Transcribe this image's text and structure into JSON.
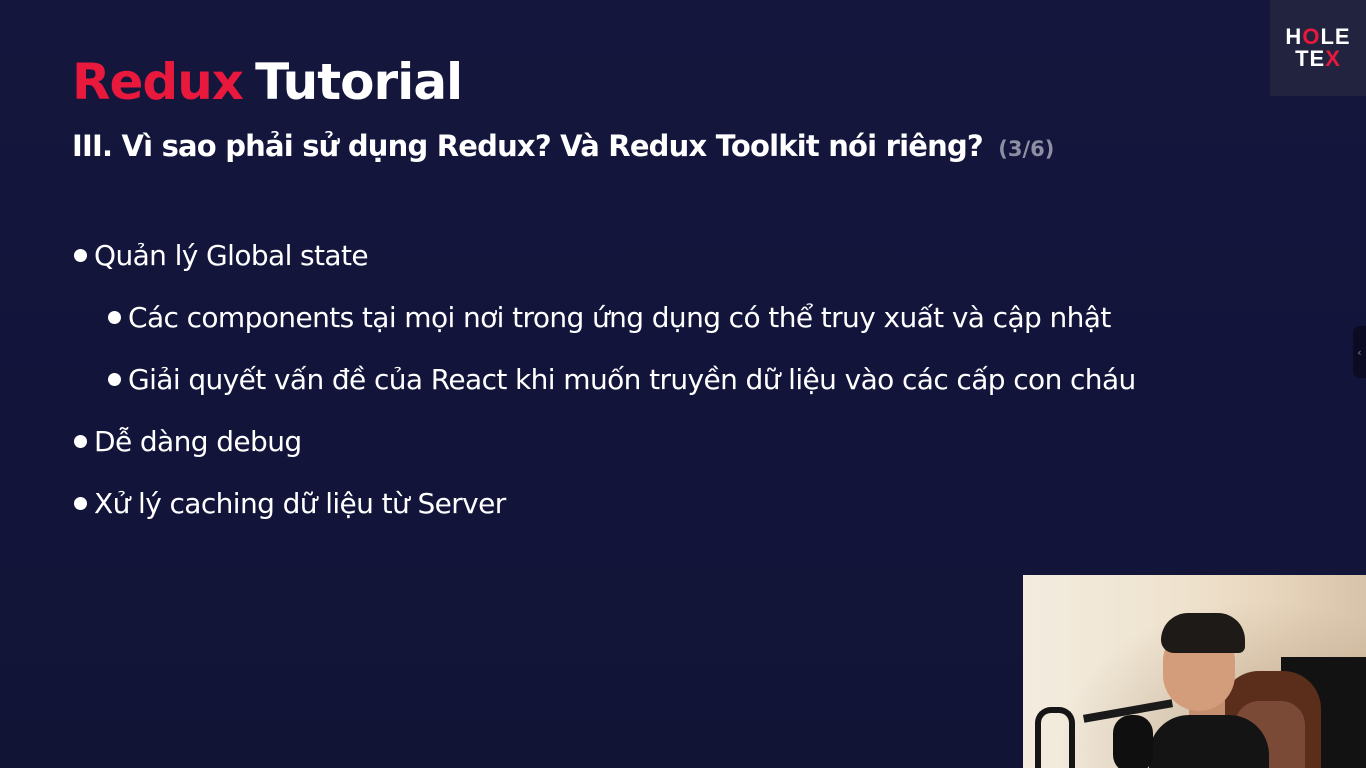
{
  "slide": {
    "title_part1": "Redux",
    "title_part2": "Tutorial",
    "subtitle": "III. Vì sao phải sử dụng Redux? Và Redux Toolkit nói riêng?",
    "counter": "(3/6)",
    "bullets": [
      "Quản lý Global state",
      "Các components tại mọi nơi trong ứng dụng có thể truy xuất và cập nhật",
      "Giải quyết vấn đề của React khi muốn truyền dữ liệu vào các cấp con cháu",
      "Dễ dàng debug",
      "Xử lý caching dữ liệu từ Server"
    ]
  },
  "logo": {
    "line1_a": "H",
    "line1_b": "O",
    "line1_c": "LE",
    "line2_a": "TE",
    "line2_b": "X"
  },
  "side_handle": {
    "icon": "chevron-left-icon",
    "glyph": "‹"
  },
  "colors": {
    "background": "#13153b",
    "accent_red": "#e8193c",
    "counter_gray": "#8e8ea4"
  }
}
